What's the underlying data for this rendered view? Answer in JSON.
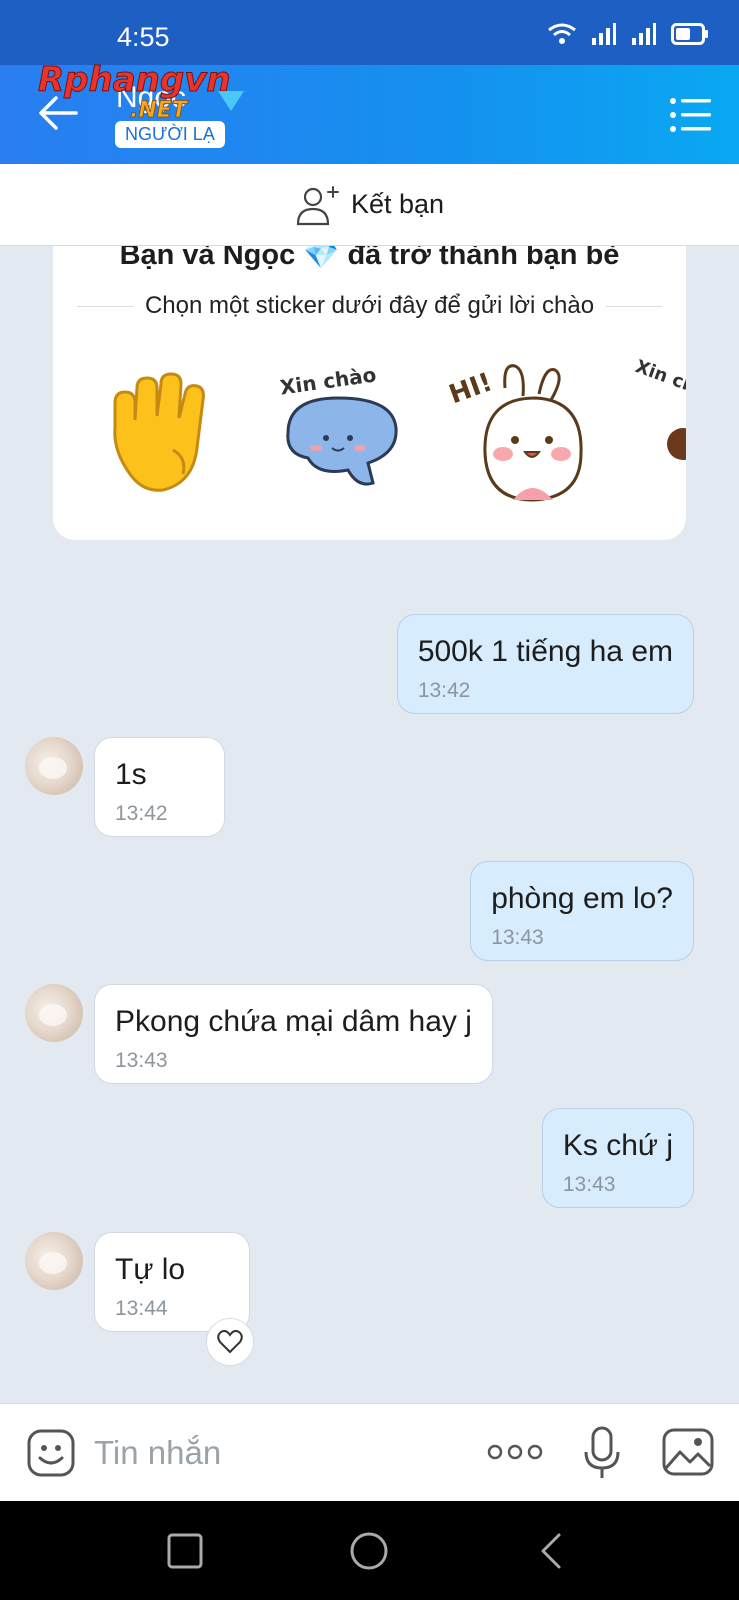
{
  "status_bar": {
    "time": "4:55"
  },
  "header": {
    "contact_name": "Ngọc",
    "stranger_badge": "NGƯỜI LẠ",
    "watermark": "Rphangvn .NET"
  },
  "add_friend": {
    "label": "Kết bạn"
  },
  "friend_card": {
    "title": "Bạn và Ngọc 💎 đã trở thành bạn bè",
    "subtitle": "Chọn một sticker dưới đây để gửi lời chào",
    "stickers": [
      {
        "name": "waving-hand",
        "text": ""
      },
      {
        "name": "cat-xin-chao",
        "text": "Xin chào"
      },
      {
        "name": "bunny-hi",
        "text": "HI!"
      },
      {
        "name": "xin-chao-partial",
        "text": "Xin chà"
      }
    ]
  },
  "messages": [
    {
      "direction": "out",
      "text": "500k 1 tiếng ha em",
      "time": "13:42"
    },
    {
      "direction": "in",
      "text": "1s",
      "time": "13:42"
    },
    {
      "direction": "out",
      "text": "phòng em lo?",
      "time": "13:43"
    },
    {
      "direction": "in",
      "text": "Pkong chứa mại dâm hay j",
      "time": "13:43"
    },
    {
      "direction": "out",
      "text": "Ks chứ j",
      "time": "13:43"
    },
    {
      "direction": "in",
      "text": "Tự lo",
      "time": "13:44"
    }
  ],
  "input_bar": {
    "placeholder": "Tin nhắn"
  },
  "colors": {
    "header_start": "#2a7ef0",
    "header_end": "#0aa8f2",
    "bubble_out": "#d7ecfd",
    "bubble_in": "#ffffff",
    "chat_bg": "#e2e9f1"
  }
}
